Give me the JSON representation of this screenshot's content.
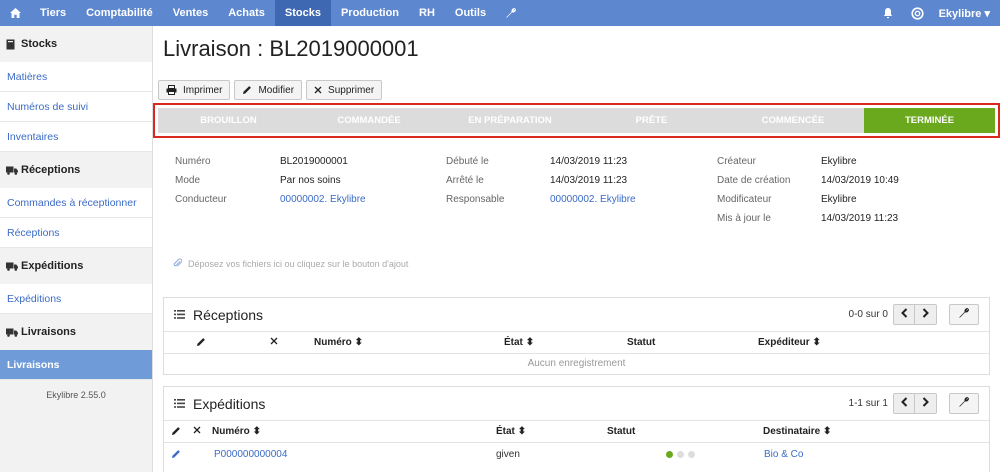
{
  "topnav": {
    "items": [
      "Tiers",
      "Comptabilité",
      "Ventes",
      "Achats",
      "Stocks",
      "Production",
      "RH",
      "Outils"
    ],
    "active_index": 4,
    "user": "Ekylibre",
    "icons": [
      "home-icon",
      "wrench-icon",
      "bell-icon",
      "help-icon",
      "chevron-down-icon"
    ],
    "bg_color": "#5d87cf"
  },
  "sidebar": {
    "sections": [
      {
        "title": "Stocks",
        "icon": "book-icon",
        "links": [
          "Matières",
          "Numéros de suivi",
          "Inventaires"
        ]
      },
      {
        "title": "Réceptions",
        "icon": "truck-icon",
        "links": [
          "Commandes à réceptionner",
          "Réceptions"
        ]
      },
      {
        "title": "Expéditions",
        "icon": "truck-icon",
        "links": [
          "Expéditions"
        ]
      },
      {
        "title": "Livraisons",
        "icon": "truck-icon",
        "links": [
          "Livraisons"
        ]
      }
    ],
    "active_link": "Livraisons",
    "version": "Ekylibre 2.55.0"
  },
  "page": {
    "title": "Livraison : BL2019000001",
    "buttons": {
      "print": "Imprimer",
      "edit": "Modifier",
      "delete": "Supprimer"
    }
  },
  "steps": {
    "items": [
      "BROUILLON",
      "COMMANDÉE",
      "EN PRÉPARATION",
      "PRÊTE",
      "COMMENCÉE",
      "TERMINÉE"
    ],
    "current": "TERMINÉE",
    "done_color": "#6aa81e"
  },
  "details": {
    "col1": [
      {
        "label": "Numéro",
        "value": "BL2019000001"
      },
      {
        "label": "Mode",
        "value": "Par nos soins"
      },
      {
        "label": "Conducteur",
        "value": "00000002. Ekylibre",
        "link": true
      }
    ],
    "col2": [
      {
        "label": "Débuté le",
        "value": "14/03/2019 11:23"
      },
      {
        "label": "Arrêté le",
        "value": "14/03/2019 11:23"
      },
      {
        "label": "Responsable",
        "value": "00000002. Ekylibre",
        "link": true
      }
    ],
    "col3": [
      {
        "label": "Créateur",
        "value": "Ekylibre"
      },
      {
        "label": "Date de création",
        "value": "14/03/2019 10:49"
      },
      {
        "label": "Modificateur",
        "value": "Ekylibre"
      },
      {
        "label": "Mis à jour le",
        "value": "14/03/2019 11:23"
      }
    ]
  },
  "dropzone": "Déposez vos fichiers ici ou cliquez sur le bouton d'ajout",
  "receptions": {
    "title": "Réceptions",
    "count": "0-0 sur 0",
    "columns": {
      "numero": "Numéro",
      "etat": "État",
      "statut": "Statut",
      "expediteur": "Expéditeur"
    },
    "empty": "Aucun enregistrement"
  },
  "expeditions": {
    "title": "Expéditions",
    "count": "1-1 sur 1",
    "columns": {
      "numero": "Numéro",
      "etat": "État",
      "statut": "Statut",
      "destinataire": "Destinataire"
    },
    "rows": [
      {
        "numero": "P000000000004",
        "etat": "given",
        "statut": "1 of 3",
        "destinataire": "Bio & Co"
      }
    ]
  }
}
